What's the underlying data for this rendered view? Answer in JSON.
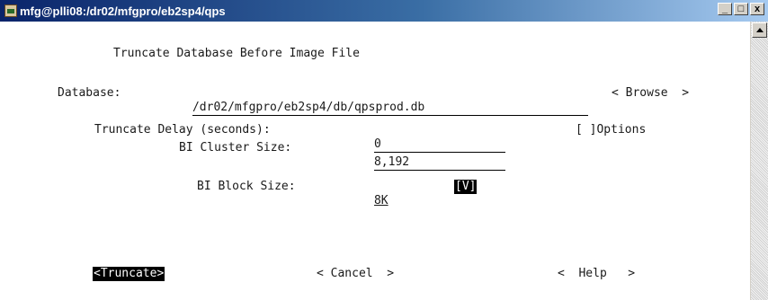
{
  "window": {
    "title": "mfg@plli08:/dr02/mfgpro/eb2sp4/qps",
    "min_symbol": "_",
    "max_symbol": "□",
    "close_symbol": "x"
  },
  "screen": {
    "heading": "Truncate Database Before Image File",
    "database_label": "Database:",
    "database_value": "/dr02/mfgpro/eb2sp4/db/qpsprod.db",
    "browse_button": "< Browse  >",
    "truncate_delay_label": "Truncate Delay (seconds):",
    "truncate_delay_value": "0",
    "options_toggle": "[ ]Options",
    "bi_cluster_label": "BI Cluster Size:",
    "bi_cluster_value": "8,192",
    "bi_block_label": "BI Block Size:",
    "bi_block_value": "8K",
    "bi_block_dropdown": "[V]",
    "truncate_button": "<Truncate>",
    "cancel_button": "< Cancel  >",
    "help_button": "<  Help   >"
  },
  "colors": {
    "titlebar_start": "#0a246a",
    "titlebar_end": "#a6caf0",
    "highlight_bg": "#000000",
    "highlight_fg": "#ffffff"
  }
}
